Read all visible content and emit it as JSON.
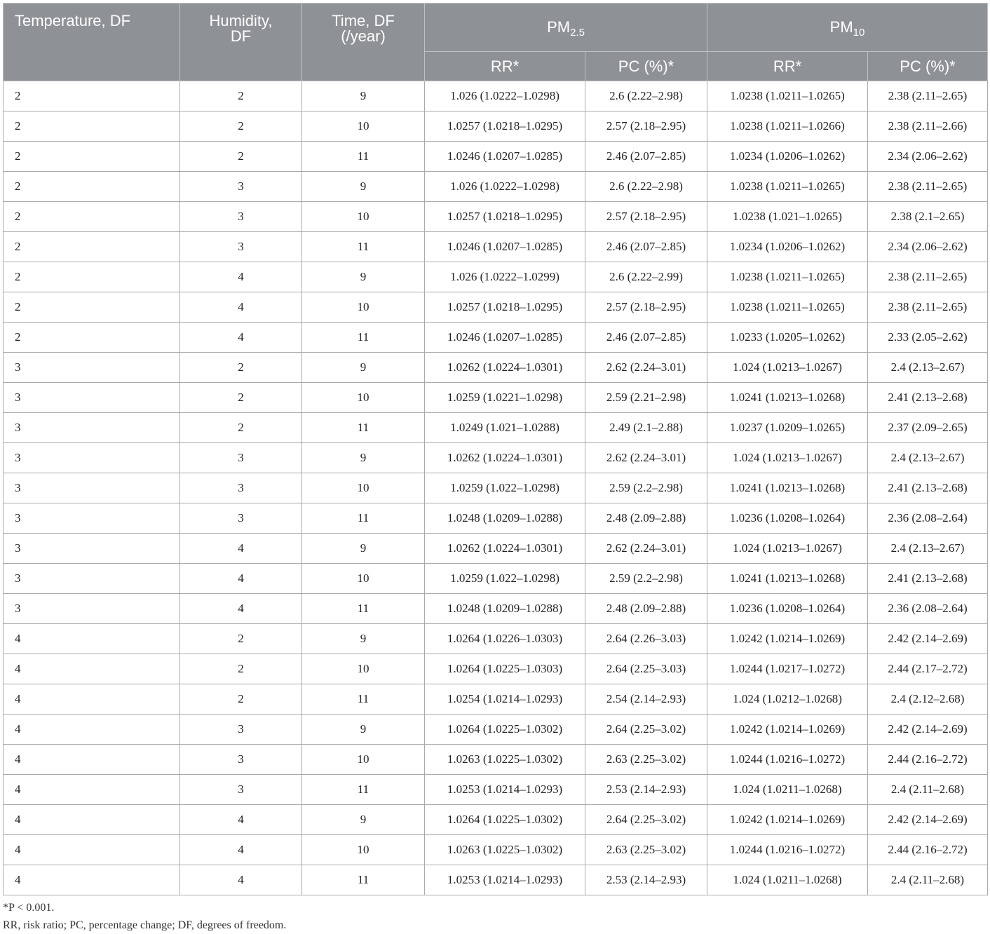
{
  "headers": {
    "temperature": [
      "Temperature, DF"
    ],
    "humidity": [
      "Humidity,",
      "DF"
    ],
    "time": [
      "Time, DF",
      "(/year)"
    ],
    "pm25": {
      "base": "PM",
      "sub": "2.5"
    },
    "pm10": {
      "base": "PM",
      "sub": "10"
    },
    "rr": "RR*",
    "pc": "PC (%)*"
  },
  "rows": [
    [
      "2",
      "2",
      "9",
      "1.026 (1.0222–1.0298)",
      "2.6 (2.22–2.98)",
      "1.0238 (1.0211–1.0265)",
      "2.38 (2.11–2.65)"
    ],
    [
      "2",
      "2",
      "10",
      "1.0257 (1.0218–1.0295)",
      "2.57 (2.18–2.95)",
      "1.0238 (1.0211–1.0266)",
      "2.38 (2.11–2.66)"
    ],
    [
      "2",
      "2",
      "11",
      "1.0246 (1.0207–1.0285)",
      "2.46 (2.07–2.85)",
      "1.0234 (1.0206–1.0262)",
      "2.34 (2.06–2.62)"
    ],
    [
      "2",
      "3",
      "9",
      "1.026 (1.0222–1.0298)",
      "2.6 (2.22–2.98)",
      "1.0238 (1.0211–1.0265)",
      "2.38 (2.11–2.65)"
    ],
    [
      "2",
      "3",
      "10",
      "1.0257 (1.0218–1.0295)",
      "2.57 (2.18–2.95)",
      "1.0238 (1.021–1.0265)",
      "2.38 (2.1–2.65)"
    ],
    [
      "2",
      "3",
      "11",
      "1.0246 (1.0207–1.0285)",
      "2.46 (2.07–2.85)",
      "1.0234 (1.0206–1.0262)",
      "2.34 (2.06–2.62)"
    ],
    [
      "2",
      "4",
      "9",
      "1.026 (1.0222–1.0299)",
      "2.6 (2.22–2.99)",
      "1.0238 (1.0211–1.0265)",
      "2.38 (2.11–2.65)"
    ],
    [
      "2",
      "4",
      "10",
      "1.0257 (1.0218–1.0295)",
      "2.57 (2.18–2.95)",
      "1.0238 (1.0211–1.0265)",
      "2.38 (2.11–2.65)"
    ],
    [
      "2",
      "4",
      "11",
      "1.0246 (1.0207–1.0285)",
      "2.46 (2.07–2.85)",
      "1.0233 (1.0205–1.0262)",
      "2.33 (2.05–2.62)"
    ],
    [
      "3",
      "2",
      "9",
      "1.0262 (1.0224–1.0301)",
      "2.62 (2.24–3.01)",
      "1.024 (1.0213–1.0267)",
      "2.4 (2.13–2.67)"
    ],
    [
      "3",
      "2",
      "10",
      "1.0259 (1.0221–1.0298)",
      "2.59 (2.21–2.98)",
      "1.0241 (1.0213–1.0268)",
      "2.41 (2.13–2.68)"
    ],
    [
      "3",
      "2",
      "11",
      "1.0249 (1.021–1.0288)",
      "2.49 (2.1–2.88)",
      "1.0237 (1.0209–1.0265)",
      "2.37 (2.09–2.65)"
    ],
    [
      "3",
      "3",
      "9",
      "1.0262 (1.0224–1.0301)",
      "2.62 (2.24–3.01)",
      "1.024 (1.0213–1.0267)",
      "2.4 (2.13–2.67)"
    ],
    [
      "3",
      "3",
      "10",
      "1.0259 (1.022–1.0298)",
      "2.59 (2.2–2.98)",
      "1.0241 (1.0213–1.0268)",
      "2.41 (2.13–2.68)"
    ],
    [
      "3",
      "3",
      "11",
      "1.0248 (1.0209–1.0288)",
      "2.48 (2.09–2.88)",
      "1.0236 (1.0208–1.0264)",
      "2.36 (2.08–2.64)"
    ],
    [
      "3",
      "4",
      "9",
      "1.0262 (1.0224–1.0301)",
      "2.62 (2.24–3.01)",
      "1.024 (1.0213–1.0267)",
      "2.4 (2.13–2.67)"
    ],
    [
      "3",
      "4",
      "10",
      "1.0259 (1.022–1.0298)",
      "2.59 (2.2–2.98)",
      "1.0241 (1.0213–1.0268)",
      "2.41 (2.13–2.68)"
    ],
    [
      "3",
      "4",
      "11",
      "1.0248 (1.0209–1.0288)",
      "2.48 (2.09–2.88)",
      "1.0236 (1.0208–1.0264)",
      "2.36 (2.08–2.64)"
    ],
    [
      "4",
      "2",
      "9",
      "1.0264 (1.0226–1.0303)",
      "2.64 (2.26–3.03)",
      "1.0242 (1.0214–1.0269)",
      "2.42 (2.14–2.69)"
    ],
    [
      "4",
      "2",
      "10",
      "1.0264 (1.0225–1.0303)",
      "2.64 (2.25–3.03)",
      "1.0244 (1.0217–1.0272)",
      "2.44 (2.17–2.72)"
    ],
    [
      "4",
      "2",
      "11",
      "1.0254 (1.0214–1.0293)",
      "2.54 (2.14–2.93)",
      "1.024 (1.0212–1.0268)",
      "2.4 (2.12–2.68)"
    ],
    [
      "4",
      "3",
      "9",
      "1.0264 (1.0225–1.0302)",
      "2.64 (2.25–3.02)",
      "1.0242 (1.0214–1.0269)",
      "2.42 (2.14–2.69)"
    ],
    [
      "4",
      "3",
      "10",
      "1.0263 (1.0225–1.0302)",
      "2.63 (2.25–3.02)",
      "1.0244 (1.0216–1.0272)",
      "2.44 (2.16–2.72)"
    ],
    [
      "4",
      "3",
      "11",
      "1.0253 (1.0214–1.0293)",
      "2.53 (2.14–2.93)",
      "1.024 (1.0211–1.0268)",
      "2.4 (2.11–2.68)"
    ],
    [
      "4",
      "4",
      "9",
      "1.0264 (1.0225–1.0302)",
      "2.64 (2.25–3.02)",
      "1.0242 (1.0214–1.0269)",
      "2.42 (2.14–2.69)"
    ],
    [
      "4",
      "4",
      "10",
      "1.0263 (1.0225–1.0302)",
      "2.63 (2.25–3.02)",
      "1.0244 (1.0216–1.0272)",
      "2.44 (2.16–2.72)"
    ],
    [
      "4",
      "4",
      "11",
      "1.0253 (1.0214–1.0293)",
      "2.53 (2.14–2.93)",
      "1.024 (1.0211–1.0268)",
      "2.4 (2.11–2.68)"
    ]
  ],
  "footnotes": [
    "*P < 0.001.",
    "RR, risk ratio; PC, percentage change; DF, degrees of freedom."
  ],
  "colors": {
    "header_bg": "#8e9296",
    "header_text": "#ffffff",
    "grid": "#a8abae"
  }
}
